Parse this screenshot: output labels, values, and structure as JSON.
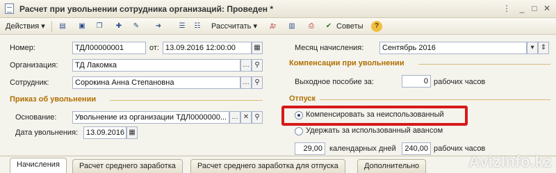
{
  "window": {
    "title": "Расчет при увольнении сотрудника организаций: Проведен *"
  },
  "toolbar": {
    "actions_label": "Действия",
    "calculate_label": "Рассчитать",
    "tips_label": "Советы"
  },
  "header": {
    "number_label": "Номер:",
    "number_value": "ТДЛ00000001",
    "from_label": "от:",
    "date_value": "13.09.2016 12:00:00",
    "org_label": "Организация:",
    "org_value": "ТД Лакомка",
    "employee_label": "Сотрудник:",
    "employee_value": "Сорокина Анна Степановна",
    "month_label": "Месяц начисления:",
    "month_value": "Сентябрь 2016"
  },
  "dismissal": {
    "section_title": "Приказ об увольнении",
    "basis_label": "Основание:",
    "basis_value": "Увольнение из организации ТДЛ0000000...",
    "date_label": "Дата увольнения:",
    "date_value": "13.09.2016"
  },
  "compensation": {
    "section_title": "Компенсации при увольнении",
    "severance_label": "Выходное пособие за:",
    "severance_value": "0",
    "severance_unit": "рабочих часов"
  },
  "vacation": {
    "section_title": "Отпуск",
    "option_compensate": "Компенсировать за неиспользованный",
    "option_withhold": "Удержать за использованный авансом",
    "calendar_days_value": "29,00",
    "calendar_days_label": "календарных дней",
    "work_hours_value": "240,00",
    "work_hours_label": "рабочих часов"
  },
  "tabs": [
    {
      "label": "Начисления"
    },
    {
      "label": "Расчет среднего заработка"
    },
    {
      "label": "Расчет среднего заработка для отпуска"
    },
    {
      "label": "Дополнительно"
    }
  ],
  "watermark": "AvizInfo.kz",
  "colors": {
    "section": "#b06f00",
    "highlight": "#d61a1a"
  }
}
